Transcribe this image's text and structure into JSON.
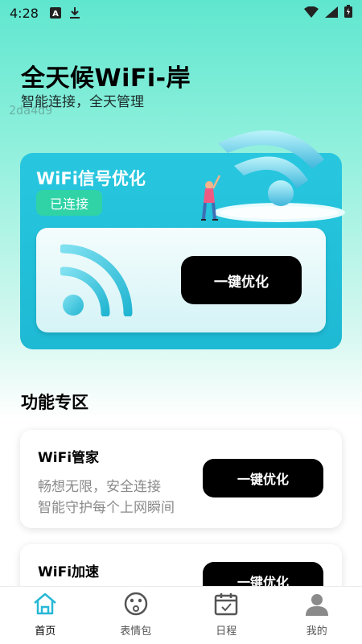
{
  "status_bar": {
    "time": "4:28",
    "left_icons": [
      "text-a-icon",
      "download-icon"
    ],
    "right_icons": [
      "wifi-icon",
      "signal-icon",
      "battery-icon"
    ]
  },
  "header": {
    "title": "全天候WiFi-岸",
    "subtitle": "智能连接，全天管理",
    "watermark": "2da4d9"
  },
  "main_card": {
    "title": "WiFi信号优化",
    "status": "已连接",
    "button_label": "一键优化"
  },
  "features": {
    "section_title": "功能专区",
    "items": [
      {
        "title": "WiFi管家",
        "desc_line1": "畅想无限，安全连接",
        "desc_line2": "智能守护每个上网瞬间",
        "button_label": "一键优化"
      },
      {
        "title": "WiFi加速",
        "button_label": "一键优化"
      }
    ]
  },
  "bottom_nav": {
    "items": [
      {
        "label": "首页",
        "icon": "home-icon",
        "active": true
      },
      {
        "label": "表情包",
        "icon": "emoji-face-icon",
        "active": false
      },
      {
        "label": "日程",
        "icon": "calendar-icon",
        "active": false
      },
      {
        "label": "我的",
        "icon": "user-icon",
        "active": false
      }
    ]
  },
  "colors": {
    "accent_teal": "#1eb9d4",
    "badge_green": "#2fd3a6",
    "button_black": "#000000",
    "nav_active": "#29b8d6"
  }
}
